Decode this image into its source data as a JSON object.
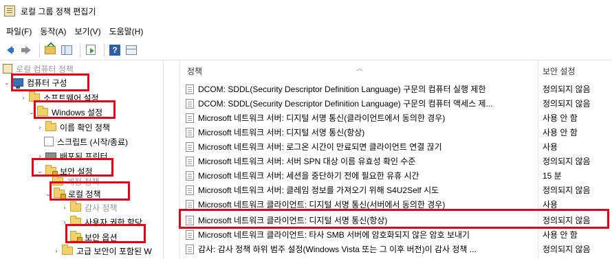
{
  "window": {
    "title": "로컬 그룹 정책 편집기"
  },
  "menu": [
    "파일(F)",
    "동작(A)",
    "보기(V)",
    "도움말(H)"
  ],
  "toolbar": {
    "buttons": [
      "back-icon",
      "forward-icon",
      "up-folder-icon",
      "show-hide-tree-icon",
      "export-list-icon",
      "help-icon",
      "properties-icon"
    ]
  },
  "tree": {
    "root": "로컬 컴퓨터 정책",
    "computer_config": "컴퓨터 구성",
    "software_settings": "소프트웨어 설정",
    "windows_settings": "Windows 설정",
    "name_resolution": "이름 확인 정책",
    "scripts": "스크립트 (시작/종료)",
    "deployed_printers": "배포된 프린터",
    "security_settings": "보안 설정",
    "account_policies": "계정 정책",
    "local_policies": "로컬 정책",
    "audit_policy": "감사 정책",
    "user_rights": "사용자 권한 할당",
    "security_options": "보안 옵션",
    "advanced_audit": "고급 보안이 포함된 W"
  },
  "columns": {
    "policy": "정책",
    "setting": "보안 설정"
  },
  "policies": [
    {
      "name": "DCOM: SDDL(Security Descriptor Definition Language) 구문의 컴퓨터 실행 제한",
      "value": "정의되지 않음"
    },
    {
      "name": "DCOM: SDDL(Security Descriptor Definition Language) 구문의 컴퓨터 액세스 제...",
      "value": "정의되지 않음"
    },
    {
      "name": "Microsoft 네트워크 서버: 디지털 서명 통신(클라이언트에서 동의한 경우)",
      "value": "사용 안 함"
    },
    {
      "name": "Microsoft 네트워크 서버: 디지털 서명 통신(항상)",
      "value": "사용 안 함"
    },
    {
      "name": "Microsoft 네트워크 서버: 로그온 시간이 만료되면 클라이언트 연결 끊기",
      "value": "사용"
    },
    {
      "name": "Microsoft 네트워크 서버: 서버 SPN 대상 이름 유효성 확인 수준",
      "value": "정의되지 않음"
    },
    {
      "name": "Microsoft 네트워크 서버: 세션을 중단하기 전에 필요한 유휴 시간",
      "value": "15 분"
    },
    {
      "name": "Microsoft 네트워크 서버: 클레임 정보를 가져오기 위해 S4U2Self 시도",
      "value": "정의되지 않음"
    },
    {
      "name": "Microsoft 네트워크 클라이언트: 디지털 서명 통신(서버에서 동의한 경우)",
      "value": "사용"
    },
    {
      "name": "Microsoft 네트워크 클라이언트: 디지털 서명 통신(항상)",
      "value": "정의되지 않음"
    },
    {
      "name": "Microsoft 네트워크 클라이언트: 타사 SMB 서버에 암호화되지 않은 암호 보내기",
      "value": "사용 안 함"
    },
    {
      "name": "감사: 감사 정책 하위 범주 설정(Windows Vista 또는 그 이후 버전)이 감사 정책 ...",
      "value": "정의되지 않음"
    }
  ],
  "highlight_color": "#e0001a"
}
